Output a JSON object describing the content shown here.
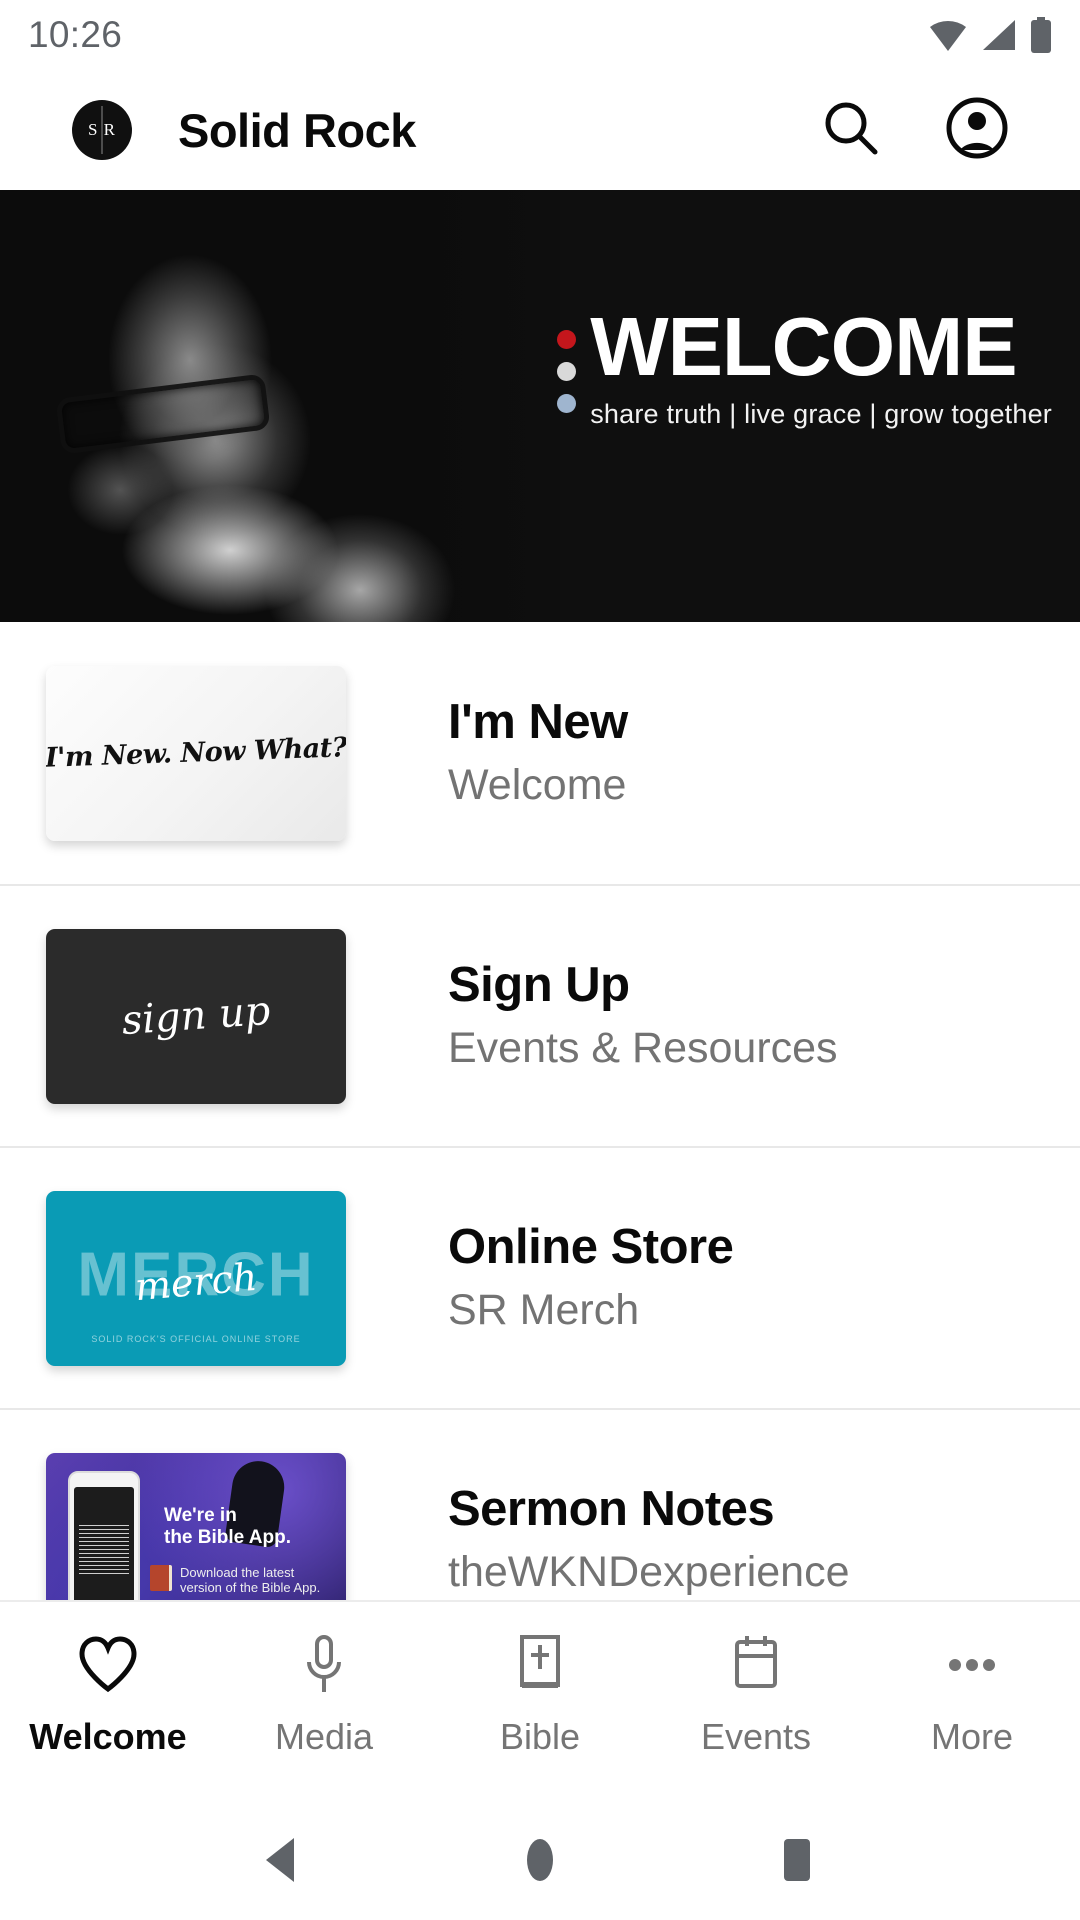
{
  "status_bar": {
    "time": "10:26",
    "icons": [
      "wifi-icon",
      "cellular-signal-icon",
      "battery-icon"
    ]
  },
  "app_bar": {
    "logo_text": "S R",
    "logo_letter_left": "S",
    "logo_letter_right": "R",
    "title": "Solid Rock",
    "actions": [
      {
        "name": "search-icon",
        "label": "Search"
      },
      {
        "name": "account-icon",
        "label": "Account"
      }
    ]
  },
  "hero": {
    "title": "WELCOME",
    "tagline": "share truth | live grace | grow together",
    "dots": [
      "#c4161c",
      "#d9d9d9",
      "#9fb5cf"
    ],
    "image_alt": "speaker-photo-grayscale"
  },
  "list": {
    "items": [
      {
        "title": "I'm New",
        "subtitle": "Welcome",
        "thumb_kind": "new-card",
        "thumb_text": "I'm New. Now What?"
      },
      {
        "title": "Sign Up",
        "subtitle": "Events & Resources",
        "thumb_kind": "signup-card",
        "thumb_text": "sign up"
      },
      {
        "title": "Online Store",
        "subtitle": "SR Merch",
        "thumb_kind": "merch-card",
        "thumb_text": "merch",
        "thumb_big_text": "MERCH",
        "thumb_small_text": "SOLID ROCK'S OFFICIAL ONLINE STORE"
      },
      {
        "title": "Sermon Notes",
        "subtitle": "theWKNDexperience",
        "thumb_kind": "bible-app-card",
        "thumb_text_1": "We're in\nthe Bible App.",
        "thumb_text_1_line1": "We're in",
        "thumb_text_1_line2": "the Bible App.",
        "thumb_text_2_line1": "Download the latest",
        "thumb_text_2_line2": "version of the Bible App."
      }
    ]
  },
  "bottom_nav": {
    "active": "Welcome",
    "items": [
      {
        "label": "Welcome",
        "icon": "heart-icon",
        "active": true
      },
      {
        "label": "Media",
        "icon": "microphone-icon",
        "active": false
      },
      {
        "label": "Bible",
        "icon": "bible-book-icon",
        "active": false
      },
      {
        "label": "Events",
        "icon": "calendar-icon",
        "active": false
      },
      {
        "label": "More",
        "icon": "ellipsis-icon",
        "active": false
      }
    ]
  },
  "system_nav": {
    "back": "back-button",
    "home": "home-button",
    "recents": "recents-button"
  },
  "colors": {
    "accent_teal": "#0a9bb5",
    "accent_red": "#c4161c",
    "text_primary": "#0a0a0a",
    "text_secondary": "#737373",
    "hero_bg": "#0f0f0f"
  }
}
